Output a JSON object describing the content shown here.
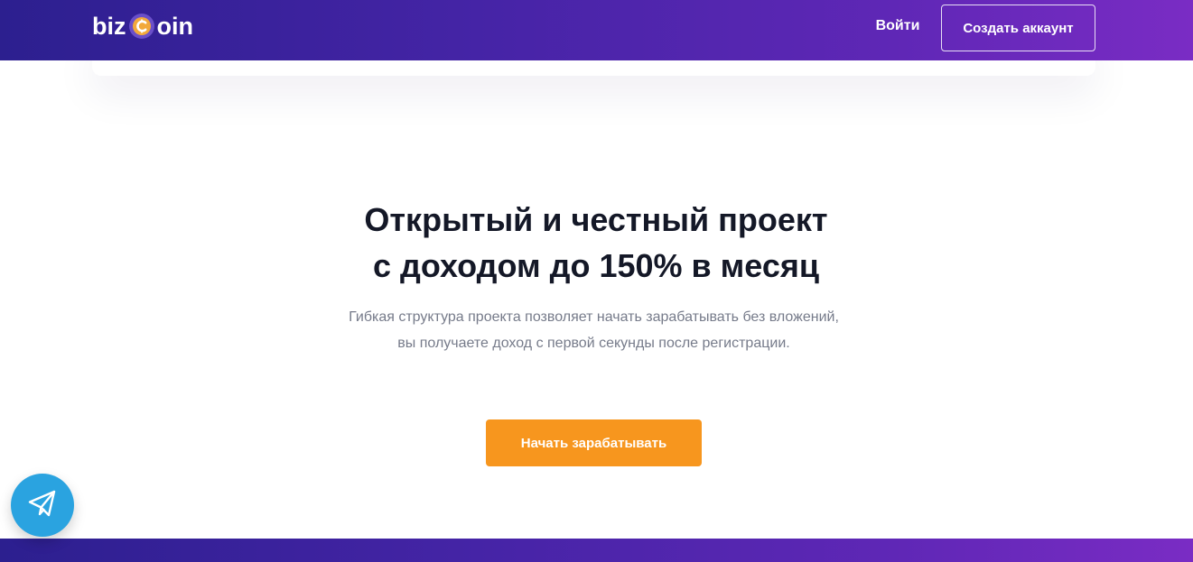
{
  "header": {
    "logo": {
      "prefix": "biz",
      "suffix": "oin",
      "coin_icon": "coin-c-icon"
    },
    "nav": {
      "login_label": "Войти",
      "signup_label": "Создать аккаунт"
    }
  },
  "hero": {
    "title_line1": "Открытый и честный проект",
    "title_line2": "с доходом до 150% в месяц",
    "description": "Гибкая структура проекта позволяет начать зарабатывать без вложений, вы получаете доход с первой секунды после регистрации.",
    "cta_label": "Начать зарабатывать"
  },
  "floating": {
    "telegram_icon": "telegram-paper-plane-icon"
  },
  "colors": {
    "header_gradient_start": "#2c1f8f",
    "header_gradient_end": "#7a2cc4",
    "accent_orange": "#f7961e",
    "telegram_blue": "#2aa3e0",
    "title_text": "#141827",
    "body_text": "#767b8a",
    "coin_gold": "#f2a93b"
  }
}
